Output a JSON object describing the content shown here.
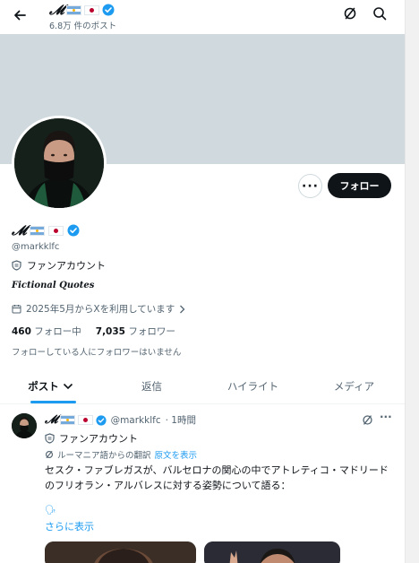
{
  "header": {
    "logo_text": "𝓜",
    "post_count": "6.8万 件のポスト",
    "icons": [
      "back-arrow-icon",
      "grok-icon",
      "search-icon"
    ]
  },
  "profile": {
    "handle": "@markklfc",
    "fan_label": "ファンアカウント",
    "bio": "Fictional Quotes",
    "joined": "2025年5月からXを利用しています",
    "following_count": "460",
    "following_label": "フォロー中",
    "followers_count": "7,035",
    "followers_label": "フォロワー",
    "followed_by": "フォローしている人にフォロワーはいません",
    "more_label": "···",
    "follow_label": "フォロー"
  },
  "tabs": [
    {
      "label": "ポスト"
    },
    {
      "label": "返信"
    },
    {
      "label": "ハイライト"
    },
    {
      "label": "メディア"
    }
  ],
  "post": {
    "handle": "@markklfc",
    "time": "· 1時間",
    "fan_label": "ファンアカウント",
    "translated_from": "ルーマニア語からの翻訳",
    "show_original": "原文を表示",
    "text": "セスク・ファブレガスが、バルセロナの関心の中でアトレティコ・マドリードのフリオラン・アルバレスに対する姿勢について語る：",
    "speech_emoji": "🗣",
    "show_more": "さらに表示",
    "more_label": "···"
  },
  "colors": {
    "accent": "#1d9bf0",
    "banner": "#cfd9de",
    "text_primary": "#0f1419",
    "text_secondary": "#536471",
    "follow_button": "#0f1419"
  }
}
